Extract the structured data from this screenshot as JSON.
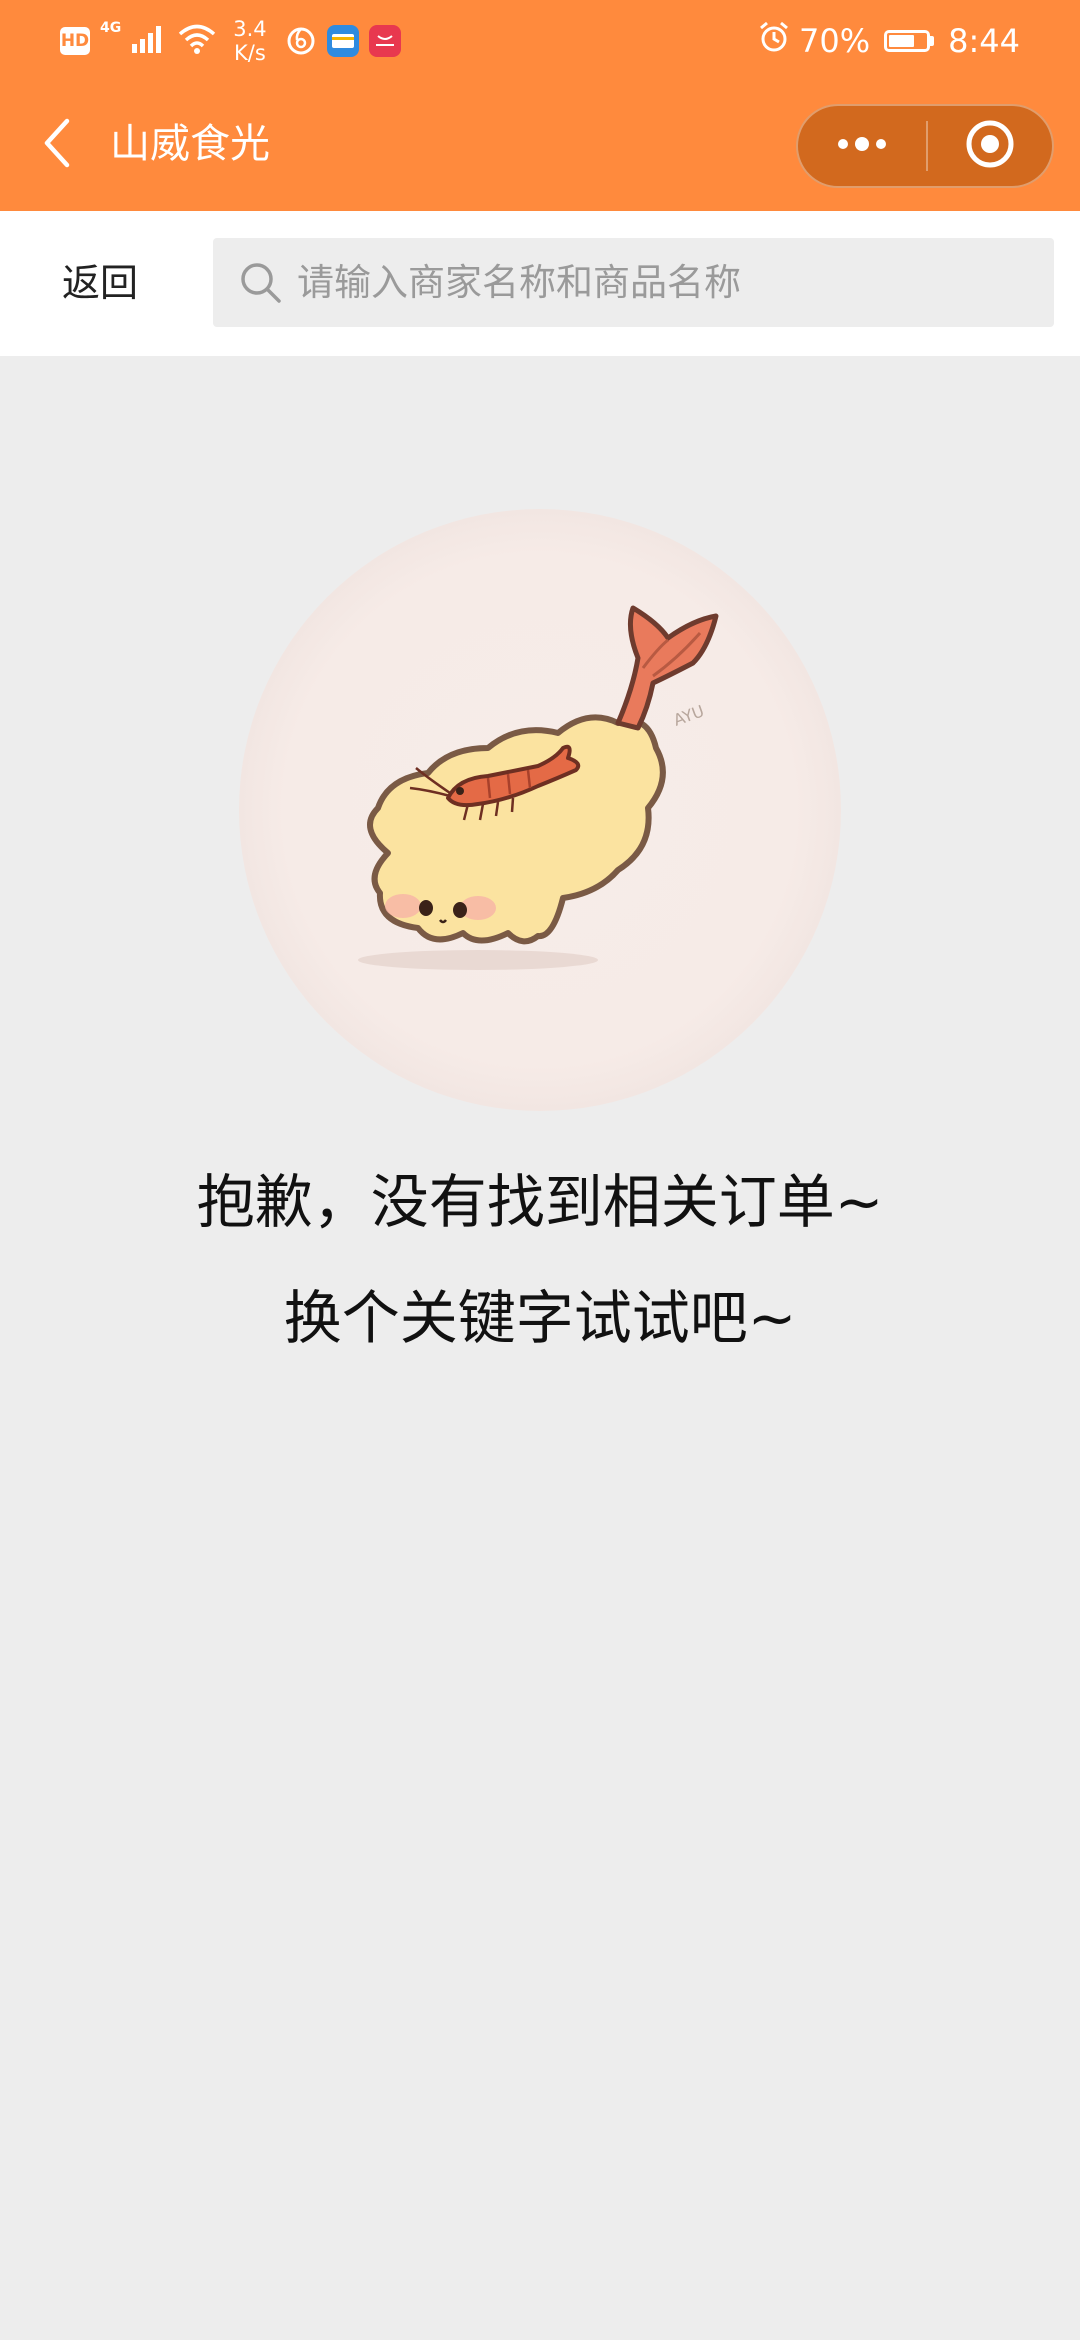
{
  "status_bar": {
    "hd_label": "HD",
    "network_type": "4G",
    "speed_value": "3.4",
    "speed_unit": "K/s",
    "battery_percent": "70%",
    "battery_level": 0.7,
    "time": "8:44",
    "icons": [
      "signal-icon",
      "wifi-icon",
      "netease-music-icon",
      "wallet-icon",
      "huawei-store-icon",
      "alarm-icon",
      "battery-icon"
    ]
  },
  "nav": {
    "title": "山威食光",
    "icons": [
      "back-arrow-icon",
      "more-dots-icon",
      "close-circle-icon"
    ]
  },
  "search": {
    "return_label": "返回",
    "placeholder": "请输入商家名称和商品名称",
    "value": ""
  },
  "empty_state": {
    "message_line1": "抱歉，没有找到相关订单~",
    "message_line2": "换个关键字试试吧~",
    "illustration": "shrimp-tempura-character",
    "illustration_signature": "AYU"
  },
  "colors": {
    "header_bg": "#ff8a3d",
    "capsule_bg": "#d2691e",
    "page_bg": "#ededed",
    "search_bg": "#ededed"
  }
}
